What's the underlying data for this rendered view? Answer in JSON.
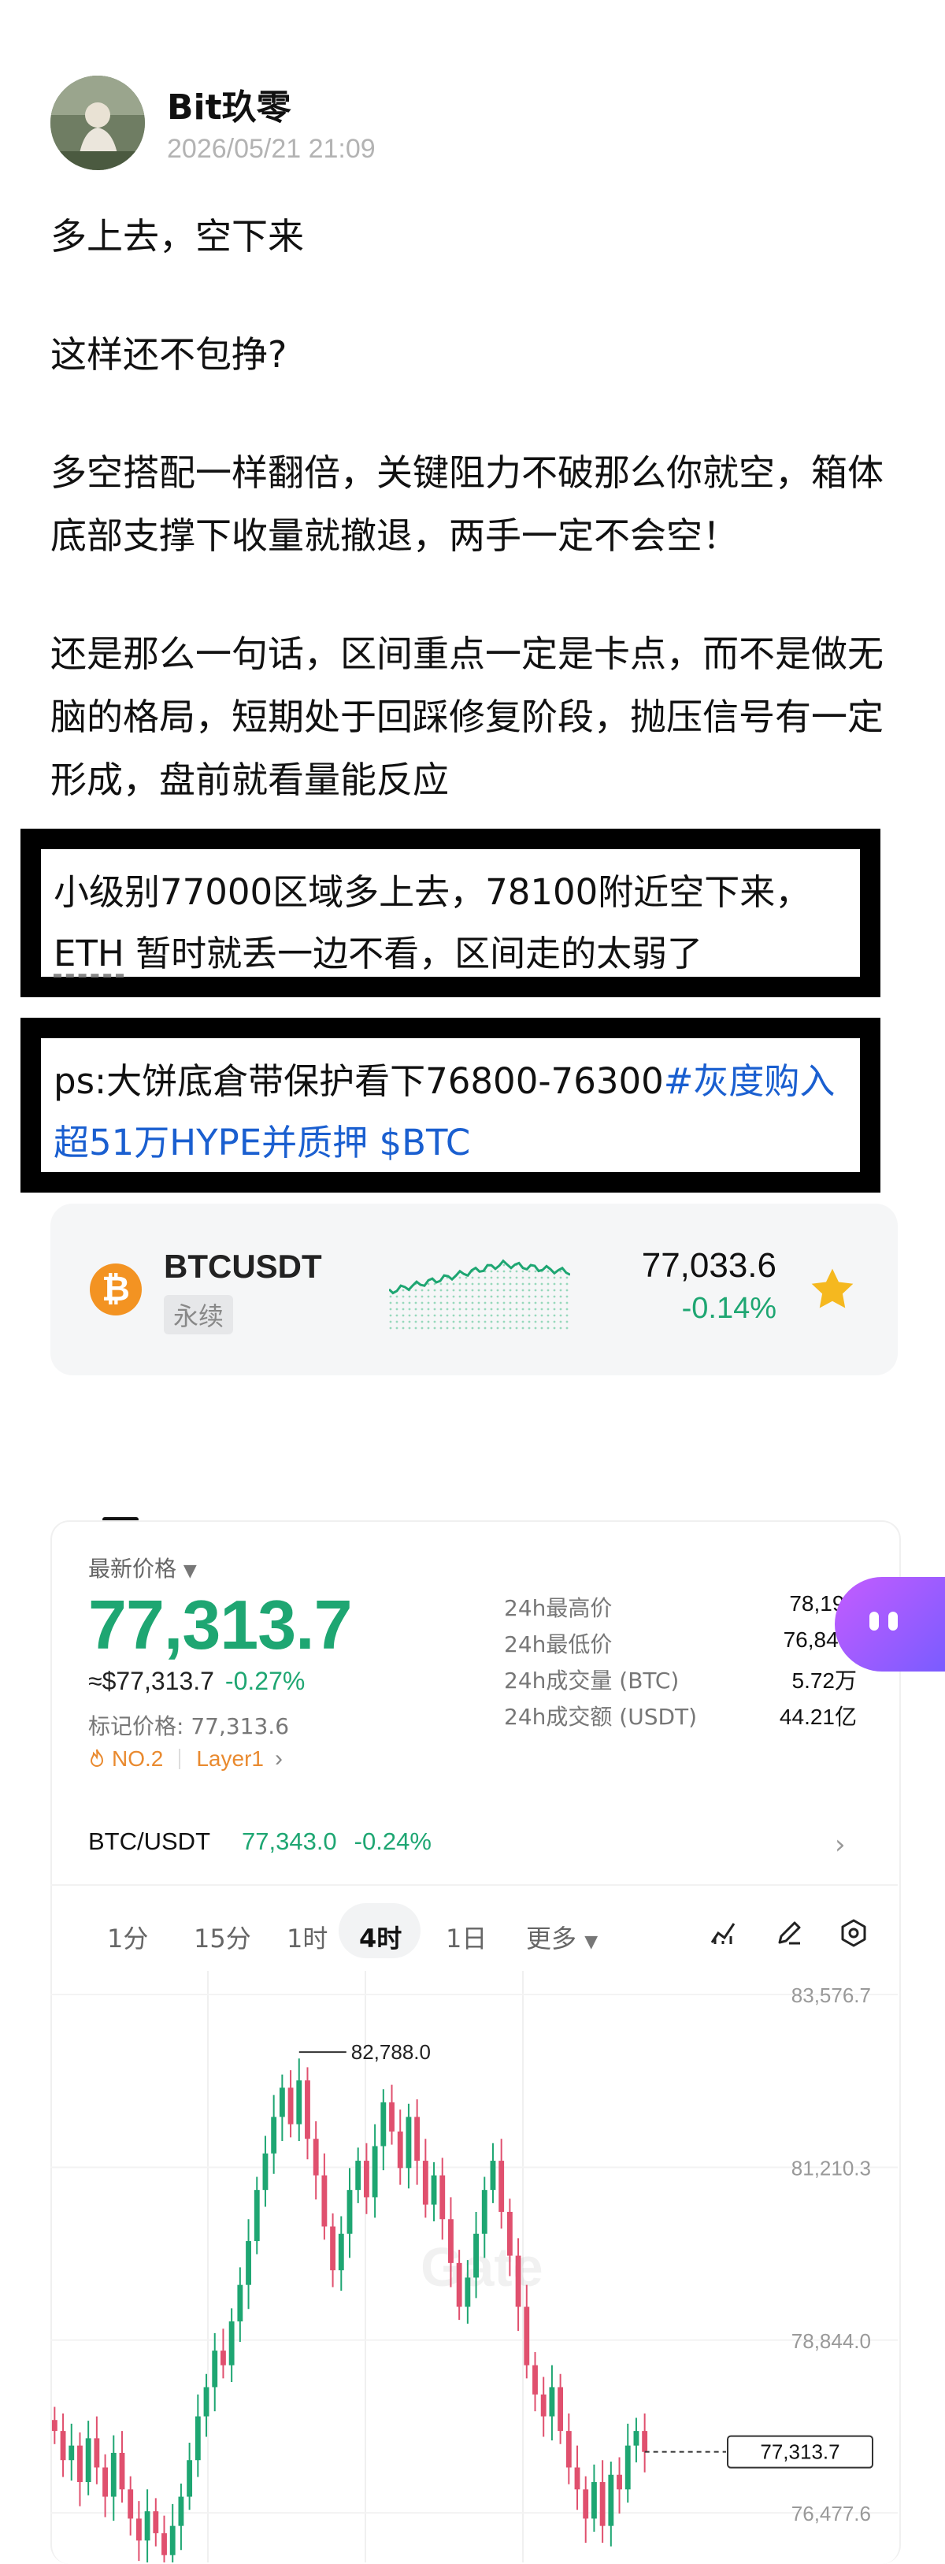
{
  "post": {
    "author": "Bit玖零",
    "timestamp": "2026/05/21 21:09",
    "paragraphs": [
      "多上去，空下来",
      "这样还不包挣?",
      "多空搭配一样翻倍，关键阻力不破那么你就空，箱体底部支撑下收量就撤退，两手一定不会空！",
      "还是那么一句话，区间重点一定是卡点，而不是做无脑的格局，短期处于回踩修复阶段，抛压信号有一定形成，盘前就看量能反应"
    ],
    "box1": {
      "line1": "小级别77000区域多上去，78100附近空下来，",
      "eth": "ETH",
      "line2_rest": " 暂时就丢一边不看，区间走的太弱了"
    },
    "box2": {
      "prefix": "ps:大饼底倉带保护看下76800-76300",
      "hashtag": "#灰度购入超51万HYPE并质押",
      "cashtag": " $BTC"
    }
  },
  "ticker": {
    "symbol": "BTCUSDT",
    "type": "永续",
    "price": "77,033.6",
    "change": "-0.14%",
    "logo_glyph": "₿",
    "favorite_icon": "star-icon",
    "accent": "#f5b81f"
  },
  "market": {
    "last_price_label": "最新价格",
    "last_price": "77,313.7",
    "usd_price": "≈$77,313.7",
    "usd_change": "-0.27%",
    "mark_price": "标记价格: 77,313.6",
    "rank": "NO.2",
    "sector": "Layer1",
    "stats": [
      {
        "label": "24h最高价",
        "value": "78,194"
      },
      {
        "label": "24h最低价",
        "value": "76,849."
      },
      {
        "label": "24h成交量 (BTC)",
        "value": "5.72万"
      },
      {
        "label": "24h成交额 (USDT)",
        "value": "44.21亿"
      }
    ],
    "pair": "BTC/USDT",
    "pair_price": "77,343.0",
    "pair_change": "-0.24%",
    "timeframes": [
      "1分",
      "15分",
      "1时",
      "4时",
      "1日",
      "更多"
    ],
    "active_timeframe": "4时",
    "up_color": "#1ea672",
    "down_color": "#e0506e"
  },
  "chart_data": {
    "type": "candlestick",
    "y_ticks": [
      "83,576.7",
      "81,210.3",
      "78,844.0",
      "76,477.6"
    ],
    "ylim": [
      75800,
      83900
    ],
    "high_label": "82,788.0",
    "current_label": "77,313.7",
    "watermark": "Gate",
    "closes": [
      77600,
      77200,
      77400,
      76900,
      77500,
      77100,
      76700,
      77300,
      76800,
      76400,
      76100,
      76500,
      76200,
      75900,
      76300,
      76700,
      77200,
      77800,
      78200,
      78700,
      78500,
      79100,
      79600,
      80200,
      80900,
      81400,
      81900,
      82300,
      81800,
      82400,
      81600,
      81100,
      80400,
      79800,
      80300,
      80900,
      81300,
      80800,
      81500,
      82100,
      81700,
      81200,
      81900,
      81300,
      80700,
      81100,
      80500,
      79900,
      79300,
      79700,
      80300,
      80900,
      81300,
      80600,
      80000,
      79300,
      78500,
      78100,
      77800,
      78200,
      77600,
      77100,
      76800,
      76400,
      76900,
      76300,
      77000,
      76800,
      77400,
      77600,
      77313
    ]
  }
}
